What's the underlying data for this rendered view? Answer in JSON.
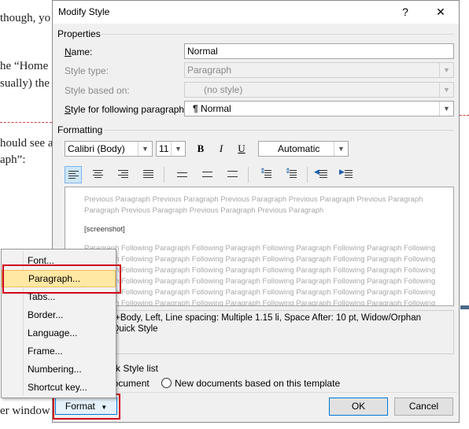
{
  "doc": {
    "lines": [
      "though,  yo",
      "he “Home",
      "sually)  the",
      "hould  see  a",
      "aph”:",
      "er  window"
    ]
  },
  "dialog": {
    "title": "Modify Style",
    "help": "?",
    "close": "✕",
    "properties_label": "Properties",
    "name_label": "Name:",
    "name_value": "Normal",
    "style_type_label": "Style type:",
    "style_type_value": "Paragraph",
    "based_on_label": "Style based on:",
    "based_on_value": "(no style)",
    "following_label": "Style for following paragraph:",
    "following_value": "Normal",
    "formatting_label": "Formatting",
    "font": "Calibri (Body)",
    "size": "11",
    "bold": "B",
    "italic": "I",
    "underline": "U",
    "color": "Automatic",
    "preview": {
      "previous": [
        "Previous Paragraph Previous Paragraph Previous Paragraph Previous Paragraph Previous Paragraph",
        "Paragraph Previous Paragraph Previous Paragraph Previous Paragraph"
      ],
      "sample": "[screenshot]",
      "following": [
        "Paragraph Following Paragraph Following Paragraph Following Paragraph Following Paragraph Following",
        "Paragraph Following Paragraph Following Paragraph Following Paragraph Following Paragraph Following",
        "Paragraph Following Paragraph Following Paragraph Following Paragraph Following Paragraph Following",
        "Paragraph Following Paragraph Following Paragraph Following Paragraph Following Paragraph Following",
        "Paragraph Following Paragraph Following Paragraph Following Paragraph Following Paragraph Following",
        "Paragraph Following Paragraph Following Paragraph Following Paragraph Following Paragraph Following"
      ]
    },
    "description": [
      "t) +Body, Left, Line spacing:  Multiple 1.15 li, Space After:  10 pt, Widow/Orphan",
      ": Quick Style"
    ],
    "quick_style": "k Style list",
    "only_doc": "document",
    "new_docs": "New documents based on this template",
    "format_button": "Format",
    "ok": "OK",
    "cancel": "Cancel"
  },
  "menu": {
    "items": [
      "Font...",
      "Paragraph...",
      "Tabs...",
      "Border...",
      "Language...",
      "Frame...",
      "Numbering...",
      "Shortcut key..."
    ],
    "highlighted": "Paragraph...",
    "highlight_color": "#ffe8a3"
  },
  "colors": {
    "annotation_red": "#d0021b",
    "accent": "#0078d7"
  }
}
